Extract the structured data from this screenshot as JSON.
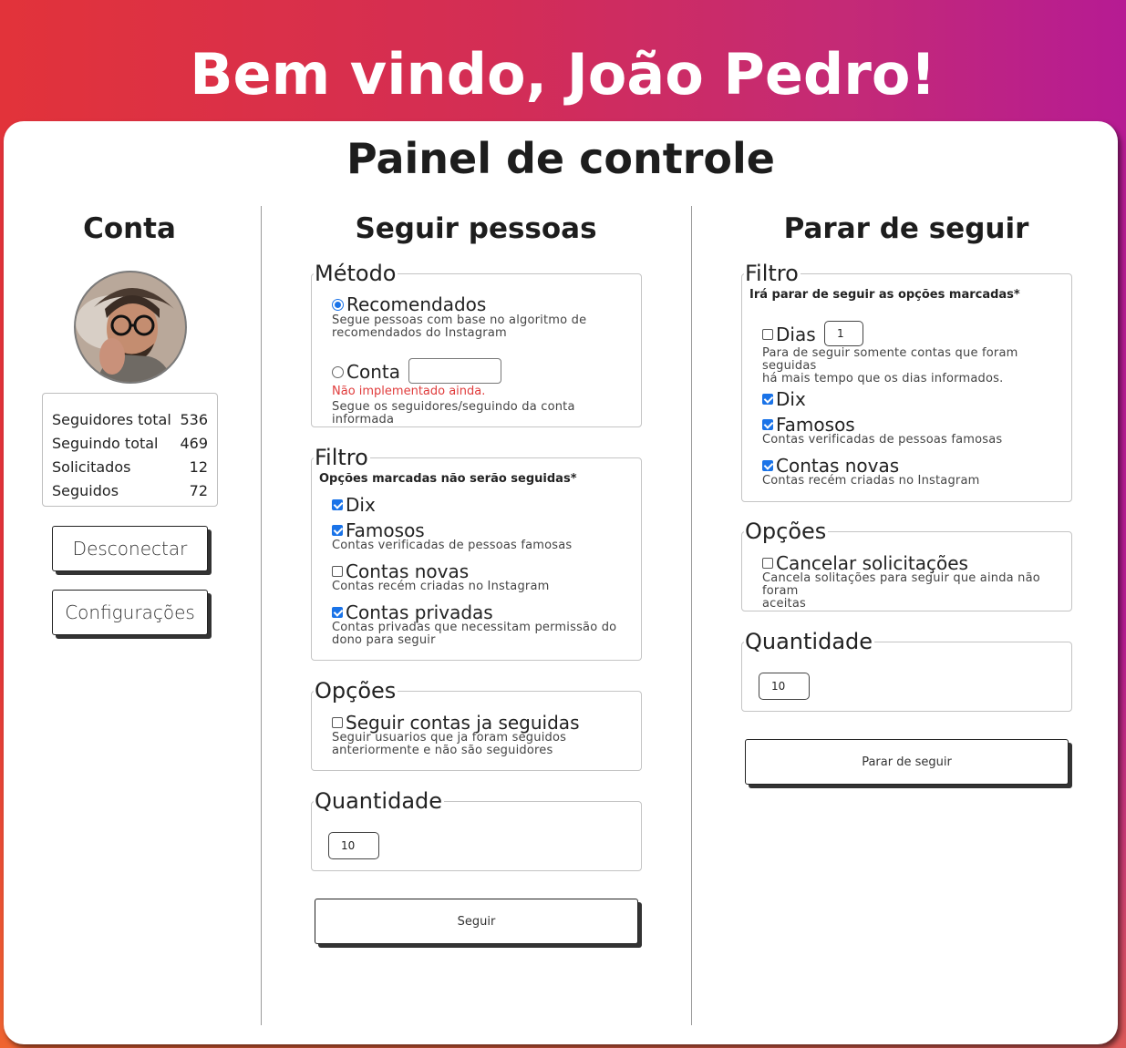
{
  "welcome": "Bem vindo, João Pedro!",
  "panel_title": "Painel de controle",
  "account": {
    "title": "Conta",
    "stats": [
      {
        "label": "Seguidores total",
        "value": "536"
      },
      {
        "label": "Seguindo total",
        "value": "469"
      },
      {
        "label": "Solicitados",
        "value": "12"
      },
      {
        "label": "Seguidos",
        "value": "72"
      }
    ],
    "disconnect_label": "Desconectar",
    "settings_label": "Configurações"
  },
  "follow": {
    "title": "Seguir pessoas",
    "method": {
      "legend": "Método",
      "recommended_label": "Recomendados",
      "recommended_checked": true,
      "recommended_desc_1": "Segue pessoas com base no algoritmo de",
      "recommended_desc_2": "recomendados do Instagram",
      "account_label": "Conta",
      "account_value": "",
      "account_warning": "Não implementado ainda.",
      "account_desc": "Segue os seguidores/seguindo da conta informada"
    },
    "filter": {
      "legend": "Filtro",
      "note": "Opções marcadas não serão seguidas*",
      "dix_label": "Dix",
      "dix_checked": true,
      "famous_label": "Famosos",
      "famous_checked": true,
      "famous_desc": "Contas verificadas de pessoas famosas",
      "new_label": "Contas novas",
      "new_checked": false,
      "new_desc": "Contas recém criadas no Instagram",
      "private_label": "Contas privadas",
      "private_checked": true,
      "private_desc_1": "Contas privadas que necessitam permissão do",
      "private_desc_2": "dono para seguir"
    },
    "options": {
      "legend": "Opções",
      "refollow_label": "Seguir contas ja seguidas",
      "refollow_checked": false,
      "refollow_desc_1": "Seguir usuarios que ja foram seguidos",
      "refollow_desc_2": "anteriormente e não são seguidores"
    },
    "quantity": {
      "legend": "Quantidade",
      "value": "10"
    },
    "button_label": "Seguir"
  },
  "unfollow": {
    "title": "Parar de seguir",
    "filter": {
      "legend": "Filtro",
      "note": "Irá parar de seguir as opções marcadas*",
      "days_label": "Dias",
      "days_checked": false,
      "days_value": "1",
      "days_desc_1": "Para de seguir somente contas que foram seguidas",
      "days_desc_2": "há mais tempo que os dias informados.",
      "dix_label": "Dix",
      "dix_checked": true,
      "famous_label": "Famosos",
      "famous_checked": true,
      "famous_desc": "Contas verificadas de pessoas famosas",
      "new_label": "Contas novas",
      "new_checked": true,
      "new_desc": "Contas recém criadas no Instagram"
    },
    "options": {
      "legend": "Opções",
      "cancel_label": "Cancelar solicitações",
      "cancel_checked": false,
      "cancel_desc_1": "Cancela solitações para seguir que ainda não foram",
      "cancel_desc_2": "aceitas"
    },
    "quantity": {
      "legend": "Quantidade",
      "value": "10"
    },
    "button_label": "Parar de seguir"
  },
  "colors": {
    "accent": "#1a73e8",
    "warning": "#e03c3c",
    "gradient_start": "#e2333a",
    "gradient_end": "#b61b93"
  }
}
